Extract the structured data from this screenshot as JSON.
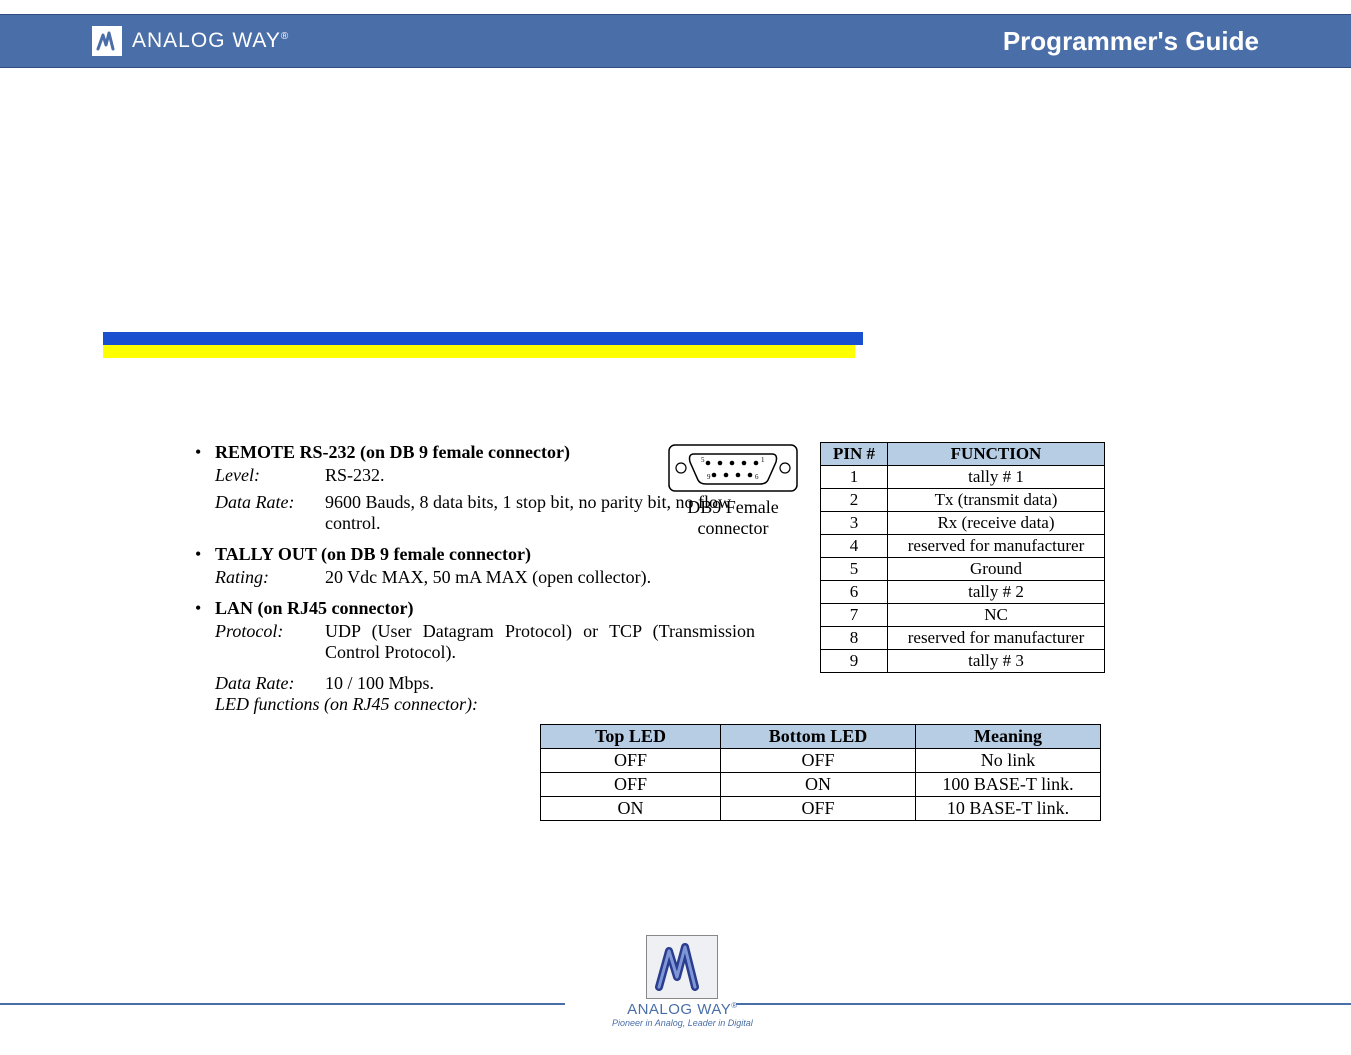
{
  "header": {
    "brand": "ANALOG WAY",
    "brand_mark": "®",
    "title": "Programmer's Guide"
  },
  "sections": {
    "rs232": {
      "title": "REMOTE RS-232 (on DB 9 female connector)",
      "level_label": "Level:",
      "level_value": "RS-232.",
      "datarate_label": "Data Rate:",
      "datarate_value": "9600 Bauds, 8 data bits, 1 stop bit, no parity bit, no flow control."
    },
    "tally": {
      "title": "TALLY OUT (on DB 9 female connector)",
      "rating_label": "Rating:",
      "rating_value": "20 Vdc MAX, 50 mA MAX (open collector)."
    },
    "lan": {
      "title": "LAN (on RJ45 connector)",
      "protocol_label": "Protocol:",
      "protocol_value": "UDP (User Datagram Protocol) or TCP (Transmission Control Protocol).",
      "datarate_label": "Data Rate:",
      "datarate_value": "10 / 100 Mbps.",
      "ledfn_label": "LED functions (on RJ45 connector):"
    }
  },
  "db9_caption_1": "DB9 Female",
  "db9_caption_2": "connector",
  "pin_table": {
    "head_pin": "PIN #",
    "head_fn": "FUNCTION",
    "rows": [
      {
        "pin": "1",
        "fn": "tally # 1"
      },
      {
        "pin": "2",
        "fn": "Tx (transmit data)"
      },
      {
        "pin": "3",
        "fn": "Rx (receive data)"
      },
      {
        "pin": "4",
        "fn": "reserved for manufacturer"
      },
      {
        "pin": "5",
        "fn": "Ground"
      },
      {
        "pin": "6",
        "fn": "tally # 2"
      },
      {
        "pin": "7",
        "fn": "NC"
      },
      {
        "pin": "8",
        "fn": "reserved for manufacturer"
      },
      {
        "pin": "9",
        "fn": "tally # 3"
      }
    ]
  },
  "led_table": {
    "head_top": "Top LED",
    "head_bottom": "Bottom LED",
    "head_meaning": "Meaning",
    "rows": [
      {
        "top": "OFF",
        "bottom": "OFF",
        "meaning": "No link"
      },
      {
        "top": "OFF",
        "bottom": "ON",
        "meaning": "100 BASE-T link."
      },
      {
        "top": "ON",
        "bottom": "OFF",
        "meaning": "10 BASE-T link."
      }
    ]
  },
  "footer": {
    "brand": "ANALOG WAY",
    "brand_mark": "®",
    "tagline": "Pioneer in Analog, Leader in Digital"
  }
}
